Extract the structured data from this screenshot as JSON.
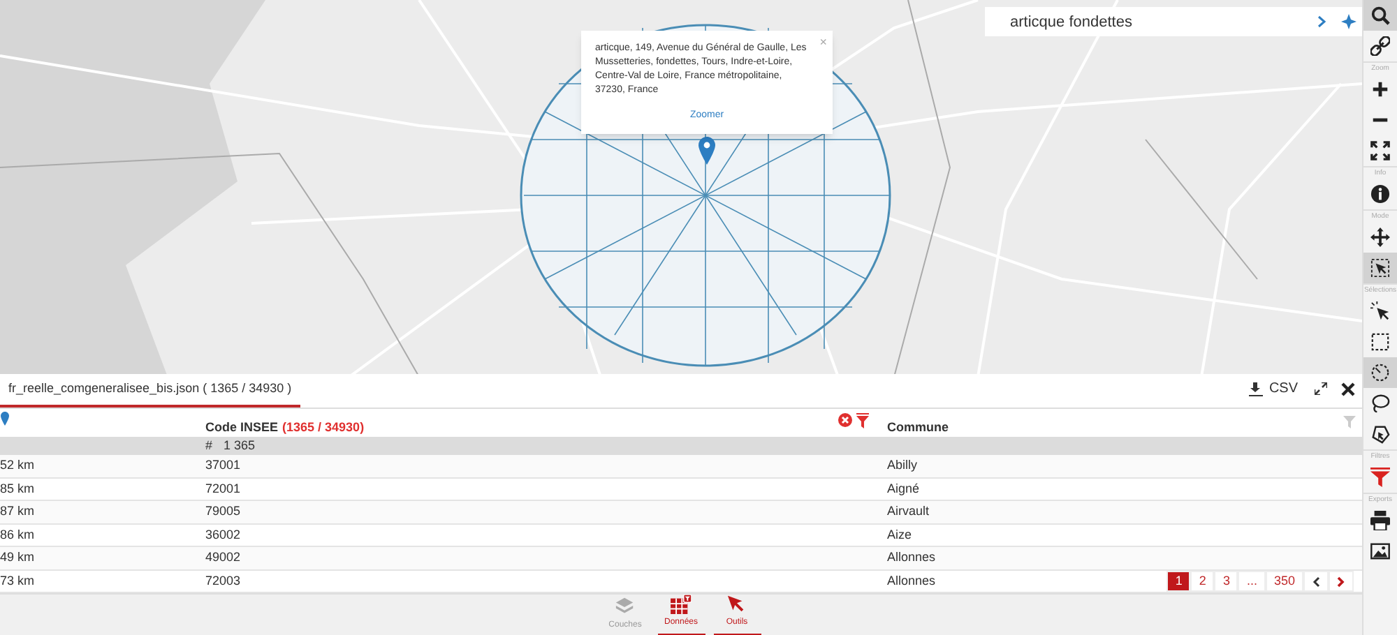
{
  "search": {
    "value": "articque fondettes"
  },
  "popup": {
    "text": "articque, 149, Avenue du Général de Gaulle, Les Mussetteries, fondettes, Tours, Indre-et-Loire, Centre-Val de Loire, France métropolitaine, 37230, France",
    "link": "Zoomer",
    "close": "×"
  },
  "toolbar": [
    {
      "kind": "button",
      "selected": true
    },
    {
      "kind": "button",
      "selected": false
    },
    {
      "kind": "section",
      "label": "Zoom"
    },
    {
      "kind": "button",
      "selected": false
    },
    {
      "kind": "button",
      "selected": false
    },
    {
      "kind": "button",
      "selected": false
    },
    {
      "kind": "section",
      "label": "Info"
    },
    {
      "kind": "button",
      "selected": false
    },
    {
      "kind": "section",
      "label": "Mode"
    },
    {
      "kind": "button",
      "selected": false
    },
    {
      "kind": "button",
      "selected": true
    },
    {
      "kind": "section",
      "label": "Sélections"
    },
    {
      "kind": "button",
      "selected": false
    },
    {
      "kind": "button",
      "selected": false
    },
    {
      "kind": "button",
      "selected": true
    },
    {
      "kind": "button",
      "selected": false
    },
    {
      "kind": "button",
      "selected": false
    },
    {
      "kind": "section",
      "label": "Filtres"
    },
    {
      "kind": "button",
      "selected": false
    },
    {
      "kind": "section",
      "label": "Exports"
    },
    {
      "kind": "button",
      "selected": false
    },
    {
      "kind": "button",
      "selected": false
    }
  ],
  "table": {
    "tab": "fr_reelle_comgeneralisee_bis.json ( 1365 / 34930 )",
    "csv": "CSV",
    "columns": [
      {
        "kind": "location"
      },
      {
        "kind": "text",
        "label": "Code INSEE",
        "count": "(1365 / 34930)"
      },
      {
        "kind": "text",
        "label": "Commune"
      }
    ],
    "summary": {
      "symbol": "#",
      "count": "1 365"
    },
    "rows": [
      [
        "52 km",
        "37001",
        "Abilly"
      ],
      [
        "85 km",
        "72001",
        "Aigné"
      ],
      [
        "87 km",
        "79005",
        "Airvault"
      ],
      [
        "86 km",
        "36002",
        "Aize"
      ],
      [
        "49 km",
        "49002",
        "Allonnes"
      ],
      [
        "73 km",
        "72003",
        "Allonnes"
      ]
    ],
    "pages": [
      {
        "label": "1",
        "selected": true
      },
      {
        "label": "2",
        "selected": false
      },
      {
        "label": "3",
        "selected": false
      },
      {
        "label": "...",
        "selected": false
      },
      {
        "label": "350",
        "selected": false
      }
    ]
  },
  "bottom_tabs": [
    {
      "label": "Couches",
      "selected": false
    },
    {
      "label": "Données",
      "selected": true
    },
    {
      "label": "Outils",
      "selected": true
    }
  ]
}
